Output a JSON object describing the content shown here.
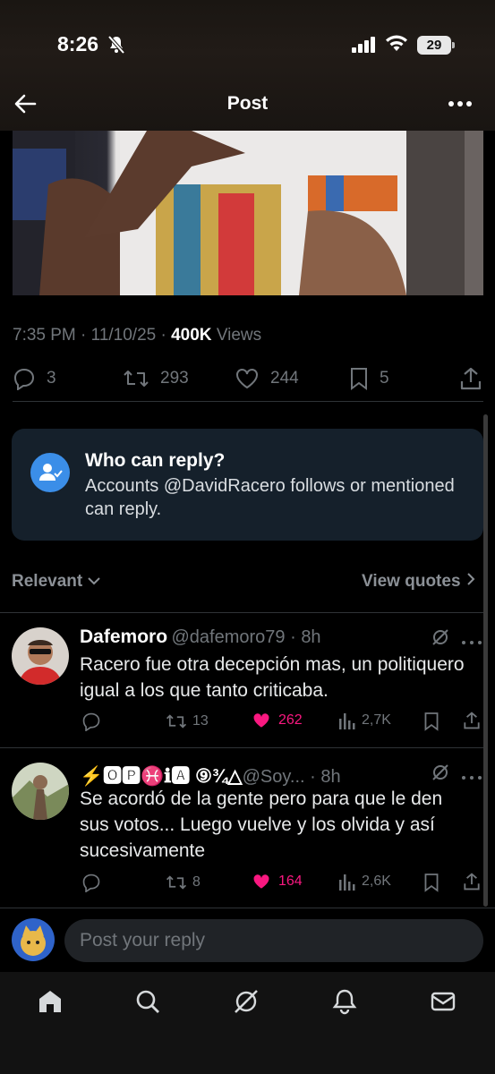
{
  "status_bar": {
    "time": "8:26",
    "battery": "29"
  },
  "header": {
    "title": "Post"
  },
  "tweet_meta": {
    "time": "7:35 PM",
    "date": "11/10/25",
    "views_count": "400K",
    "views_label": "Views"
  },
  "tweet_actions": {
    "replies": "3",
    "reposts": "293",
    "likes": "244",
    "bookmarks": "5"
  },
  "who_can_reply": {
    "title": "Who can reply?",
    "text": "Accounts @DavidRacero follows or mentioned can reply."
  },
  "sort": {
    "label": "Relevant",
    "view_quotes": "View quotes"
  },
  "replies": [
    {
      "name": "Dafemoro",
      "handle": "@dafemoro79",
      "time": "8h",
      "text": "Racero fue otra decepción mas, un politiquero igual a los que tanto criticaba.",
      "reposts": "13",
      "likes": "262",
      "views": "2,7K"
    },
    {
      "name": "⚡🅾🅿♓ℹ🅰 ⑨¾△",
      "handle": "@Soy...",
      "time": "8h",
      "text": "Se acordó de la gente pero para que le den sus votos... Luego vuelve y los olvida y así sucesivamente",
      "reposts": "8",
      "likes": "164",
      "views": "2,6K"
    }
  ],
  "compose": {
    "placeholder": "Post your reply"
  },
  "colors": {
    "accent": "#1d9bf0",
    "like": "#f91880",
    "card": "#15202b"
  }
}
